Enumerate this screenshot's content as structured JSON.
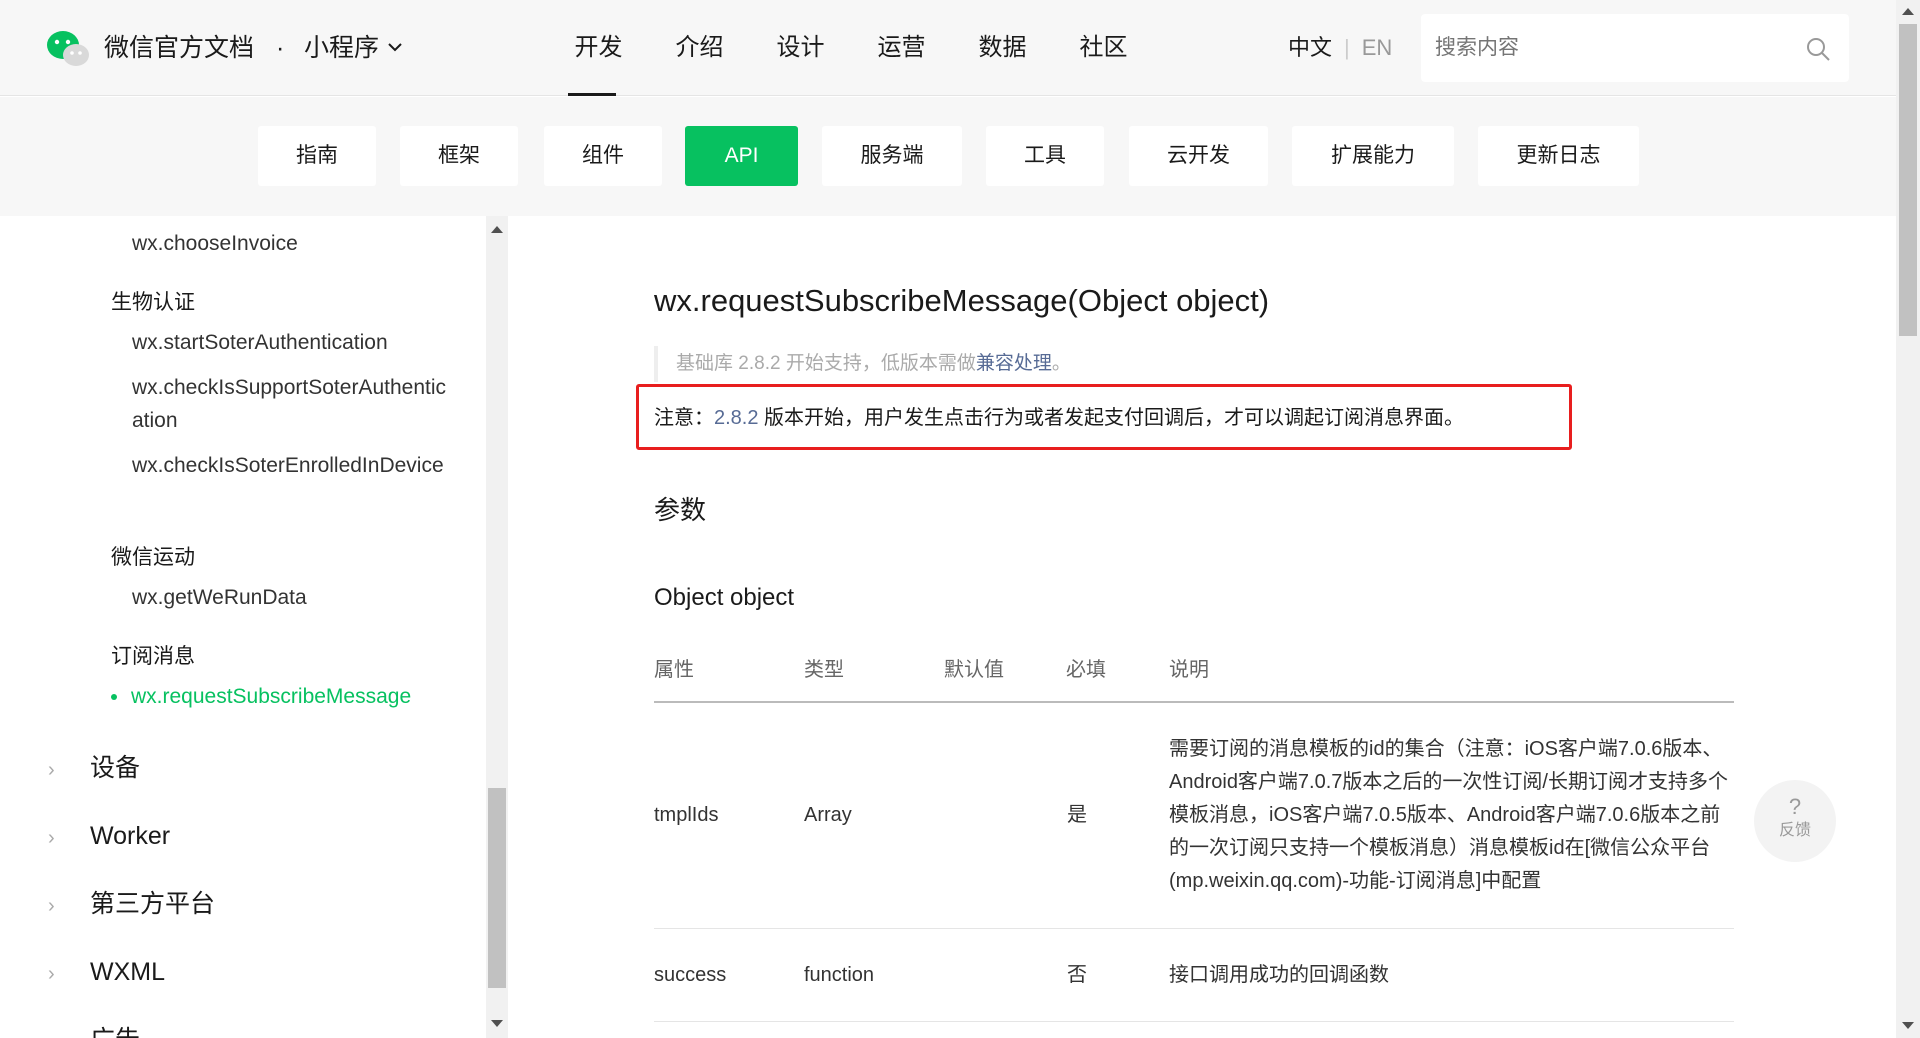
{
  "header": {
    "brand": "微信官方文档",
    "dot": "·",
    "product": "小程序",
    "nav": [
      "开发",
      "介绍",
      "设计",
      "运营",
      "数据",
      "社区"
    ],
    "active_nav": "开发",
    "lang_zh": "中文",
    "lang_sep": "|",
    "lang_en": "EN",
    "search_placeholder": "搜索内容"
  },
  "subnav": {
    "items": [
      "指南",
      "框架",
      "组件",
      "API",
      "服务端",
      "工具",
      "云开发",
      "扩展能力",
      "更新日志"
    ],
    "active": "API"
  },
  "sidebar": {
    "items": {
      "choose_invoice": "wx.chooseInvoice",
      "group_bio": "生物认证",
      "start_soter": "wx.startSoterAuthentication",
      "check_support_soter": "wx.checkIsSupportSoterAuthentication",
      "check_enrolled": "wx.checkIsSoterEnrolledInDevice",
      "group_werun": "微信运动",
      "get_werun": "wx.getWeRunData",
      "group_subscribe": "订阅消息",
      "request_subscribe": "wx.requestSubscribeMessage"
    },
    "sections": [
      "设备",
      "Worker",
      "第三方平台",
      "WXML",
      "广告"
    ]
  },
  "main": {
    "title": "wx.requestSubscribeMessage(Object object)",
    "support_prefix": "基础库 2.8.2 开始支持，低版本需做",
    "support_link": "兼容处理",
    "support_suffix": "。",
    "note_prefix": "注意：",
    "note_version": "2.8.2",
    "note_text": " 版本开始，用户发生点击行为或者发起支付回调后，才可以调起订阅消息界面。",
    "params_heading": "参数",
    "object_heading": "Object object",
    "table": {
      "headers": [
        "属性",
        "类型",
        "默认值",
        "必填",
        "说明"
      ],
      "rows": [
        {
          "name": "tmplIds",
          "type": "Array",
          "default": "",
          "required": "是",
          "desc": "需要订阅的消息模板的id的集合（注意：iOS客户端7.0.6版本、Android客户端7.0.7版本之后的一次性订阅/长期订阅才支持多个模板消息，iOS客户端7.0.5版本、Android客户端7.0.6版本之前的一次订阅只支持一个模板消息）消息模板id在[微信公众平台(mp.weixin.qq.com)-功能-订阅消息]中配置"
        },
        {
          "name": "success",
          "type": "function",
          "default": "",
          "required": "否",
          "desc": "接口调用成功的回调函数"
        }
      ]
    }
  },
  "feedback": {
    "icon": "?",
    "label": "反馈"
  },
  "colors": {
    "accent": "#07c160",
    "link": "#576b95",
    "highlight_border": "#e81e1e"
  }
}
